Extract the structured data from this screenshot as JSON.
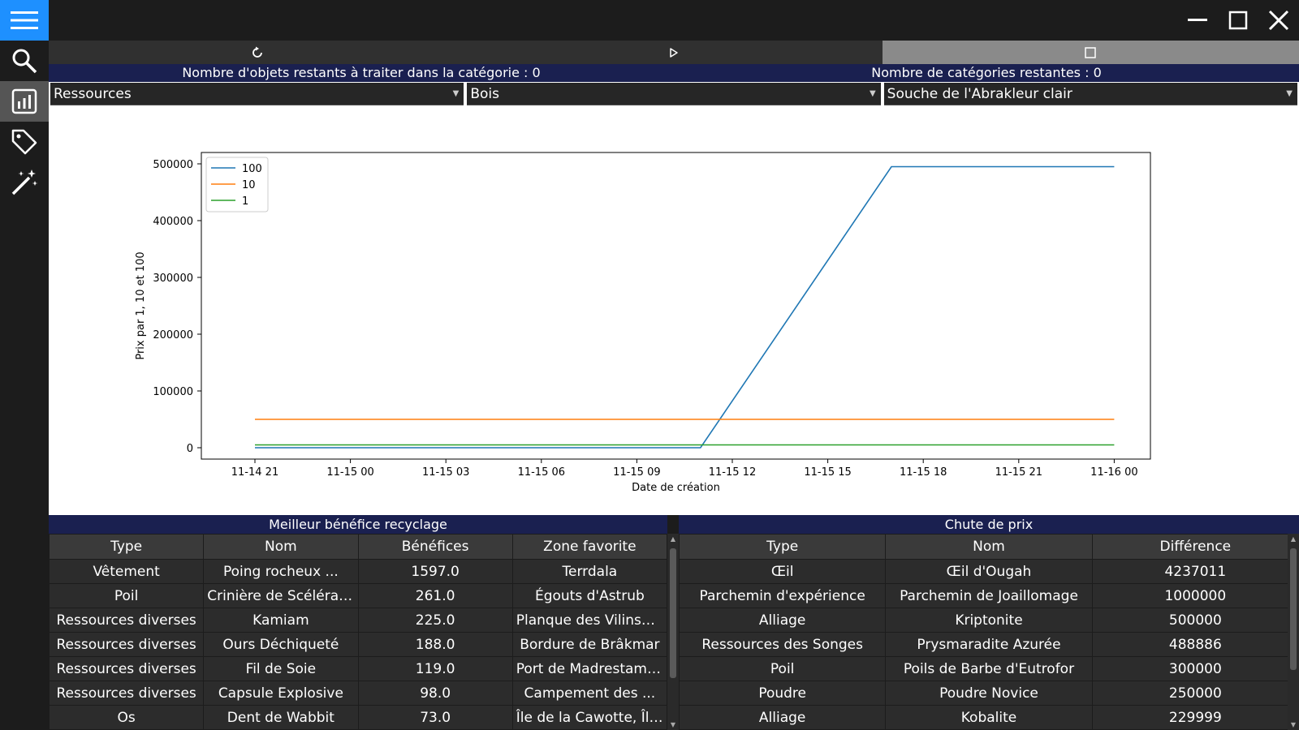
{
  "sidebar": {
    "items": [
      {
        "icon": "menu-icon"
      },
      {
        "icon": "search-icon"
      },
      {
        "icon": "chart-icon"
      },
      {
        "icon": "tag-icon"
      },
      {
        "icon": "magic-wand-icon"
      }
    ]
  },
  "window": {
    "min_icon": "minimize-icon",
    "max_icon": "maximize-icon",
    "close_icon": "close-icon"
  },
  "toolbar": {
    "refresh_icon": "refresh-icon",
    "play_icon": "play-icon",
    "stop_icon": "stop-icon"
  },
  "counters": {
    "objects_remaining": "Nombre d'objets restants à traiter dans la catégorie : 0",
    "categories_remaining": "Nombre de catégories restantes : 0"
  },
  "selects": {
    "category": "Ressources",
    "subcategory": "Bois",
    "item": "Souche de l'Abrakleur clair"
  },
  "chart_data": {
    "type": "line",
    "xlabel": "Date de création",
    "ylabel": "Prix par 1, 10 et 100",
    "ylim": [
      -20000,
      520000
    ],
    "xticks": [
      "11-14 21",
      "11-15 00",
      "11-15 03",
      "11-15 06",
      "11-15 09",
      "11-15 12",
      "11-15 15",
      "11-15 18",
      "11-15 21",
      "11-16 00"
    ],
    "yticks": [
      "0",
      "100000",
      "200000",
      "300000",
      "400000",
      "500000"
    ],
    "legend_position": "top-left",
    "series": [
      {
        "name": "100",
        "color": "#1f77b4",
        "points": [
          [
            "11-14 21",
            0
          ],
          [
            "11-15 11",
            0
          ],
          [
            "11-15 17",
            495000
          ],
          [
            "11-16 00",
            495000
          ]
        ]
      },
      {
        "name": "10",
        "color": "#ff7f0e",
        "points": [
          [
            "11-14 21",
            50000
          ],
          [
            "11-16 00",
            50000
          ]
        ]
      },
      {
        "name": "1",
        "color": "#2ca02c",
        "points": [
          [
            "11-14 21",
            5000
          ],
          [
            "11-16 00",
            5000
          ]
        ]
      }
    ]
  },
  "recycling": {
    "title": "Meilleur bénéfice recyclage",
    "columns": [
      "Type",
      "Nom",
      "Bénéfices",
      "Zone favorite"
    ],
    "rows": [
      [
        "Vêtement",
        "Poing rocheux ...",
        "1597.0",
        "Terrdala"
      ],
      [
        "Poil",
        "Crinière de Scélérat ...",
        "261.0",
        "Égouts d'Astrub"
      ],
      [
        "Ressources diverses",
        "Kamiam",
        "225.0",
        "Planque des Vilinsekts"
      ],
      [
        "Ressources diverses",
        "Ours Déchiqueté",
        "188.0",
        "Bordure de Brâkmar"
      ],
      [
        "Ressources diverses",
        "Fil de Soie",
        "119.0",
        "Port de Madrestam, ..."
      ],
      [
        "Ressources diverses",
        "Capsule Explosive",
        "98.0",
        "Campement des ..."
      ],
      [
        "Os",
        "Dent de Wabbit",
        "73.0",
        "Île de la Cawotte, Îlot..."
      ]
    ]
  },
  "price_drop": {
    "title": "Chute de prix",
    "columns": [
      "Type",
      "Nom",
      "Différence"
    ],
    "rows": [
      [
        "Œil",
        "Œil d'Ougah",
        "4237011"
      ],
      [
        "Parchemin d'expérience",
        "Parchemin de Joaillomage",
        "1000000"
      ],
      [
        "Alliage",
        "Kriptonite",
        "500000"
      ],
      [
        "Ressources des Songes",
        "Prysmaradite Azurée",
        "488886"
      ],
      [
        "Poil",
        "Poils de Barbe d'Eutrofor",
        "300000"
      ],
      [
        "Poudre",
        "Poudre Novice",
        "250000"
      ],
      [
        "Alliage",
        "Kobalite",
        "229999"
      ]
    ]
  }
}
